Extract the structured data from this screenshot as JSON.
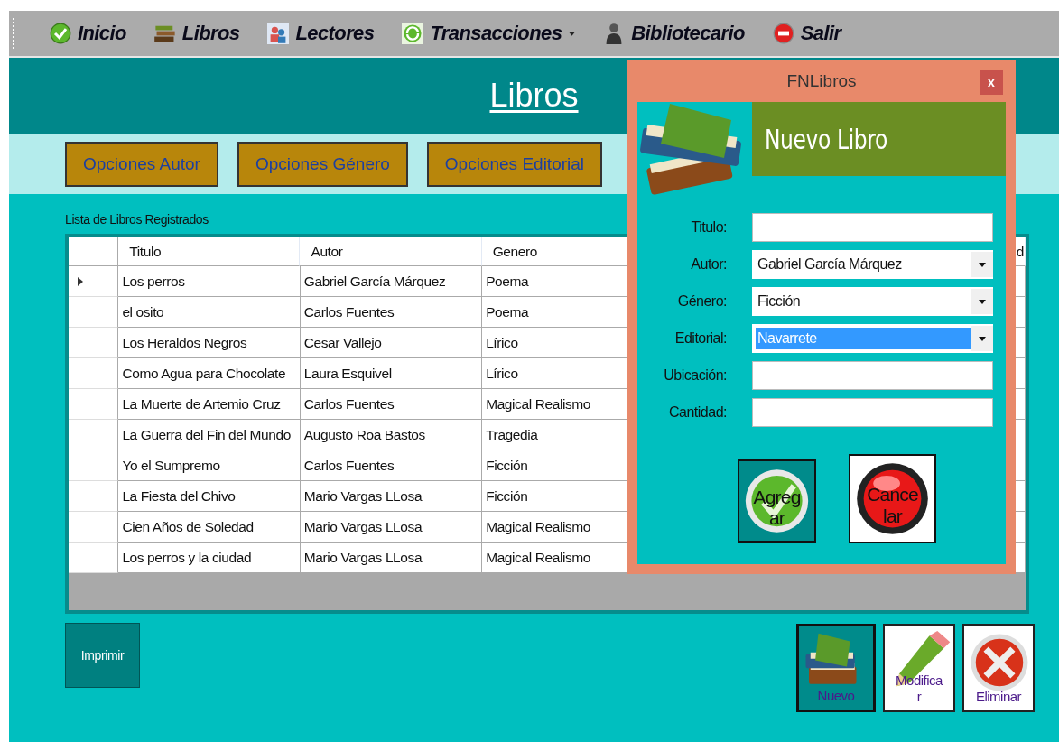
{
  "menu": [
    {
      "label": "Inicio",
      "has_submenu": false
    },
    {
      "label": "Libros",
      "has_submenu": false
    },
    {
      "label": "Lectores",
      "has_submenu": false
    },
    {
      "label": "Transacciones",
      "has_submenu": true
    },
    {
      "label": "Bibliotecario",
      "has_submenu": false
    },
    {
      "label": "Salir",
      "has_submenu": false
    }
  ],
  "page_title": "Libros",
  "option_buttons": [
    "Opciones Autor",
    "Opciones Género",
    "Opciones Editorial"
  ],
  "table": {
    "caption": "Lista de Libros Registrados",
    "columns": [
      "Titulo",
      "Autor",
      "Genero",
      "",
      "",
      "",
      "d"
    ],
    "rows": [
      {
        "current": true,
        "cells": [
          "Los perros",
          "Gabriel García Márquez",
          "Poema"
        ]
      },
      {
        "current": false,
        "cells": [
          "el osito",
          "Carlos Fuentes",
          "Poema"
        ]
      },
      {
        "current": false,
        "cells": [
          "Los Heraldos Negros",
          "Cesar Vallejo",
          "Lírico"
        ]
      },
      {
        "current": false,
        "cells": [
          "Como Agua para Chocolate",
          "Laura Esquivel",
          "Lírico"
        ]
      },
      {
        "current": false,
        "cells": [
          "La Muerte de Artemio Cruz",
          "Carlos Fuentes",
          "Magical Realismo"
        ]
      },
      {
        "current": false,
        "cells": [
          "La Guerra del Fin del Mundo",
          "Augusto Roa Bastos",
          "Tragedia"
        ]
      },
      {
        "current": false,
        "cells": [
          "Yo el Sumpremo",
          "Carlos Fuentes",
          "Ficción"
        ]
      },
      {
        "current": false,
        "cells": [
          "La Fiesta del Chivo",
          "Mario Vargas LLosa",
          "Ficción"
        ]
      },
      {
        "current": false,
        "cells": [
          "Cien Años de Soledad",
          "Mario Vargas LLosa",
          "Magical Realismo"
        ]
      },
      {
        "current": false,
        "cells": [
          "Los perros y la ciudad",
          "Mario Vargas LLosa",
          "Magical Realismo"
        ]
      }
    ]
  },
  "print_button": "Imprimir",
  "action_buttons": [
    "Nuevo",
    "Modificar",
    "Eliminar"
  ],
  "dialog": {
    "title": "FNLibros",
    "close": "x",
    "heading": "Nuevo Libro",
    "fields": [
      {
        "label": "Titulo:",
        "kind": "text",
        "highlighted": false
      },
      {
        "label": "Autor:",
        "kind": "combo",
        "value": "Gabriel García Márquez",
        "highlighted": false
      },
      {
        "label": "Género:",
        "kind": "combo",
        "value": "Ficción",
        "highlighted": false
      },
      {
        "label": "Editorial:",
        "kind": "combo",
        "value": "Navarrete",
        "highlighted": true
      },
      {
        "label": "Ubicación:",
        "kind": "text",
        "highlighted": false
      },
      {
        "label": "Cantidad:",
        "kind": "text",
        "highlighted": false
      }
    ],
    "buttons": [
      "Agregar",
      "Cancelar"
    ]
  }
}
